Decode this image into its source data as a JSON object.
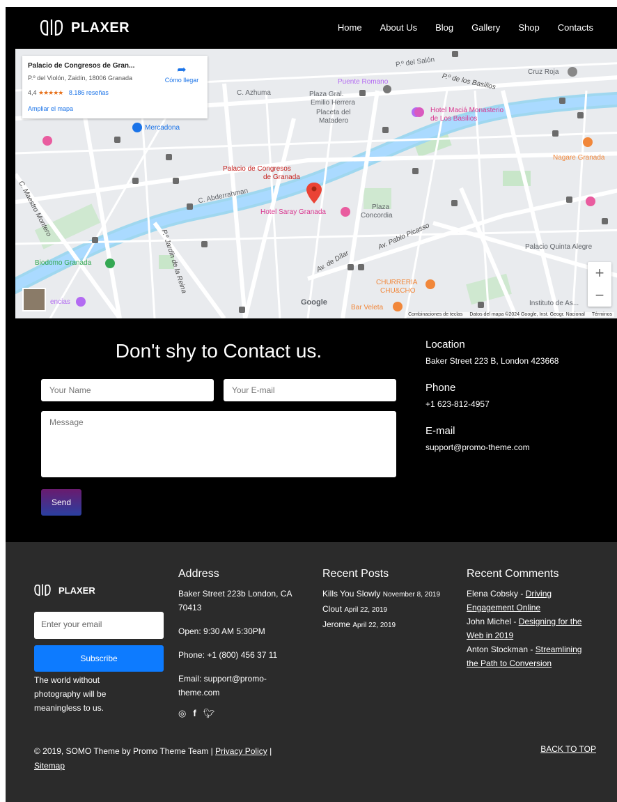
{
  "header": {
    "brand": "PLAXER",
    "nav": [
      "Home",
      "About Us",
      "Blog",
      "Gallery",
      "Shop",
      "Contacts"
    ]
  },
  "map": {
    "place_card": {
      "title": "Palacio de Congresos de Gran...",
      "address": "P.º del Violón, Zaidín, 18006 Granada",
      "rating": "4,4",
      "stars": "★★★★★",
      "reviews": "8.186 reseñas",
      "enlarge": "Ampliar el mapa",
      "directions": "Cómo llegar"
    },
    "labels": {
      "salon": "P.º del Salón",
      "cruz_roja": "Cruz Roja",
      "puente_romano": "Puente Romano",
      "basilios": "P.º de los Basilios",
      "azhuma": "C. Azhuma",
      "plaza_gral": "Plaza Gral.",
      "emilio_herrera": "Emilio Herrera",
      "placeta": "Placeta del",
      "matadero": "Matadero",
      "hotel_macia": "Hotel Maciá Monasterio",
      "de_los_basilios": "de Los Basilios",
      "mercadona": "Mercadona",
      "nagare": "Nagare Granada",
      "palacio_1": "Palacio de Congresos",
      "palacio_2": "de Granada",
      "abderrahman": "C. Abderrahman",
      "hotel_saray": "Hotel Saray Granada",
      "plaza_concordia_1": "Plaza",
      "plaza_concordia_2": "Concordia",
      "pablo_picasso": "Av. Pablo Picasso",
      "maestro_montero": "C. Maestro Montero",
      "jardin_reina": "P.º Jardín de la Reina",
      "quinta_alegre": "Palacio Quinta Alegre",
      "biodomo": "Biodomo Granada",
      "churreria_1": "CHURRERIA",
      "churreria_2": "CHU&CHO",
      "dilar": "Av. de Dílar",
      "ciencias": "encias",
      "bar_veleta": "Bar Veleta",
      "instituto": "Instituto de As...",
      "google": "Google"
    },
    "zoom_in": "+",
    "zoom_out": "−",
    "attribution": [
      "Combinaciones de teclas",
      "Datos del mapa ©2024 Google, Inst. Geogr. Nacional",
      "Términos"
    ]
  },
  "contact": {
    "title": "Don't shy to Contact us.",
    "name_placeholder": "Your Name",
    "email_placeholder": "Your E-mail",
    "message_placeholder": "Message",
    "send": "Send",
    "info": [
      {
        "label": "Location",
        "value": "Baker Street 223 B, London 423668"
      },
      {
        "label": "Phone",
        "value": "+1 623-812-4957"
      },
      {
        "label": "E-mail",
        "value": "support@promo-theme.com"
      }
    ]
  },
  "footer": {
    "brand": "PLAXER",
    "email_placeholder": "Enter your email",
    "subscribe": "Subscribe",
    "tagline": "The world without photography will be meaningless to us.",
    "address": {
      "title": "Address",
      "street": "Baker Street 223b London, CA 70413",
      "open": "Open: 9:30 AM 5:30PM",
      "phone": "Phone: +1 (800) 456 37 11",
      "email": "Email: support@promo-theme.com"
    },
    "recent_posts": {
      "title": "Recent Posts",
      "items": [
        {
          "title": "Kills You Slowly",
          "date": "November 8, 2019"
        },
        {
          "title": "Clout",
          "date": "April 22, 2019"
        },
        {
          "title": "Jerome",
          "date": "April 22, 2019"
        }
      ]
    },
    "recent_comments": {
      "title": "Recent Comments",
      "items": [
        {
          "author": "Elena Cobsky",
          "post": "Driving Engagement Online"
        },
        {
          "author": "John Michel",
          "post": "Designing for the Web in 2019"
        },
        {
          "author": "Anton Stockman",
          "post": "Streamlining the Path to Conversion"
        }
      ]
    },
    "copyright": "© 2019, SOMO Theme by Promo Theme Team |",
    "privacy": "Privacy Policy",
    "separator": "|",
    "sitemap": "Sitemap",
    "back_to_top": "BACK TO TOP"
  }
}
